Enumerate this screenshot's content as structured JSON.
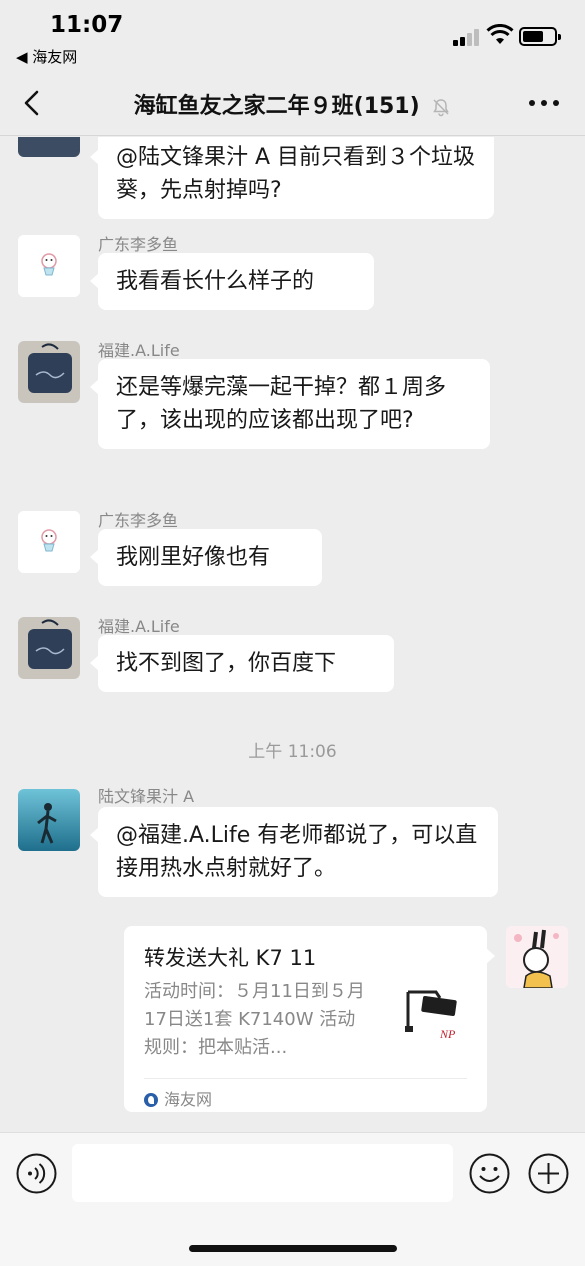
{
  "status_bar": {
    "time": "11:07",
    "back_app": "◀ 海友网"
  },
  "nav": {
    "title": "海缸鱼友之家二年９班(151)",
    "back_icon": "chevron-left-icon",
    "mute_icon": "bell-muted-icon",
    "more_icon": "more-dots-icon"
  },
  "messages": [
    {
      "sender": "",
      "text": "@陆文锋果汁 A 目前只看到３个垃圾葵，先点射掉吗?"
    },
    {
      "sender": "广东李多鱼",
      "text": "我看看长什么样子的"
    },
    {
      "sender": "福建.A.Life",
      "text": "还是等爆完藻一起干掉？都１周多了，该出现的应该都出现了吧?"
    },
    {
      "sender": "广东李多鱼",
      "text": "我刚里好像也有"
    },
    {
      "sender": "福建.A.Life",
      "text": "找不到图了，你百度下"
    },
    {
      "sender": "陆文锋果汁 A",
      "text": "@福建.A.Life 有老师都说了，可以直接用热水点射就好了。"
    }
  ],
  "timestamp": "上午 11:06",
  "card": {
    "title": "转发送大礼 K7 11",
    "description": "活动时间：５月11日到５月17日送1套 K7140W 活动规则：把本贴活...",
    "source": "海友网"
  },
  "colors": {
    "background": "#ededed",
    "bubble": "#ffffff",
    "muted_text": "#888888"
  }
}
